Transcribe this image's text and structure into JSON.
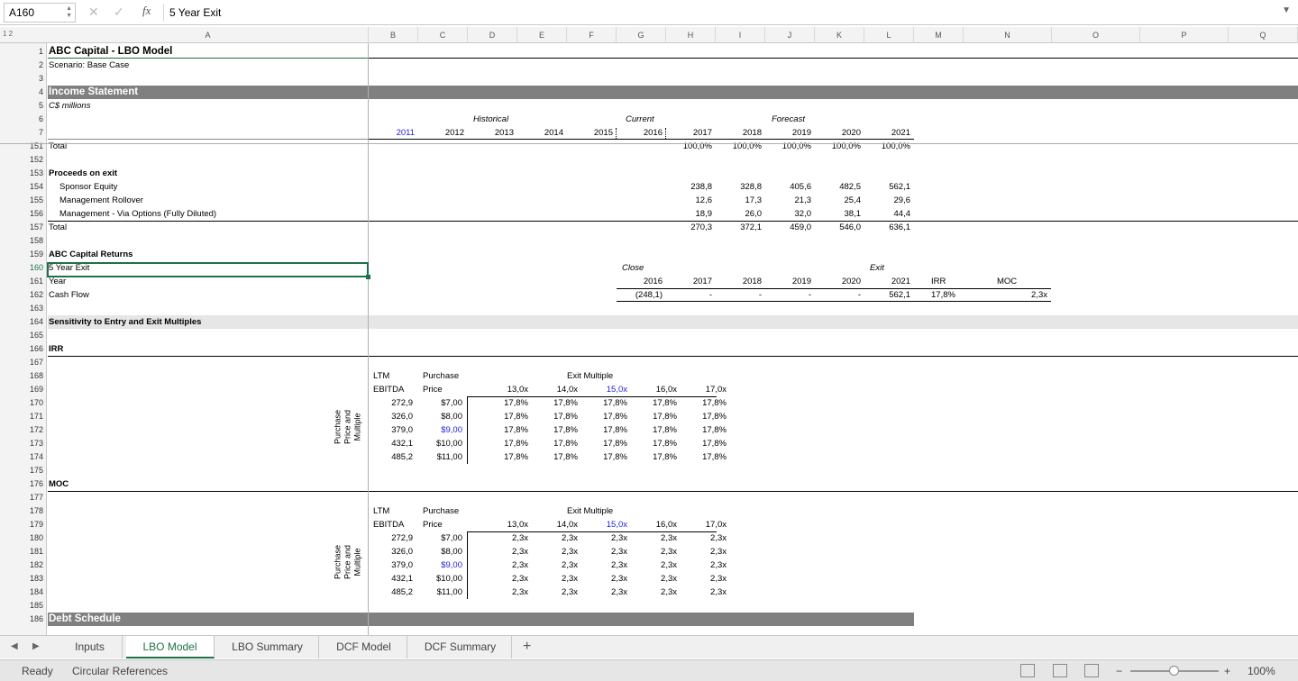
{
  "formula_bar": {
    "name_box": "A160",
    "cancel_icon": "✕",
    "confirm_icon": "✓",
    "fx_label": "fx",
    "formula": "5 Year Exit"
  },
  "outline_levels": "1 2",
  "columns": [
    "A",
    "B",
    "C",
    "D",
    "E",
    "F",
    "G",
    "H",
    "I",
    "J",
    "K",
    "L",
    "M",
    "N",
    "O",
    "P",
    "Q"
  ],
  "header_rows": {
    "r1": {
      "num": "1",
      "a": "ABC Capital - LBO Model"
    },
    "r2": {
      "num": "2",
      "a": "Scenario: Base Case"
    },
    "r3": {
      "num": "3"
    },
    "r4": {
      "num": "4",
      "a": "Income Statement"
    },
    "r5": {
      "num": "5",
      "a": "C$ millions"
    },
    "r6": {
      "num": "6",
      "historical": "Historical",
      "current": "Current",
      "forecast": "Forecast"
    },
    "r7": {
      "num": "7",
      "years": [
        "2011",
        "2012",
        "2013",
        "2014",
        "2015",
        "2016",
        "2017",
        "2018",
        "2019",
        "2020",
        "2021"
      ]
    }
  },
  "rows": {
    "r151": {
      "num": "151",
      "a": "Total",
      "values": [
        "100,0%",
        "100,0%",
        "100,0%",
        "100,0%",
        "100,0%"
      ]
    },
    "r152": {
      "num": "152"
    },
    "r153": {
      "num": "153",
      "a": "Proceeds on exit"
    },
    "r154": {
      "num": "154",
      "a": "Sponsor Equity",
      "values": [
        "238,8",
        "328,8",
        "405,6",
        "482,5",
        "562,1"
      ]
    },
    "r155": {
      "num": "155",
      "a": "Management Rollover",
      "values": [
        "12,6",
        "17,3",
        "21,3",
        "25,4",
        "29,6"
      ]
    },
    "r156": {
      "num": "156",
      "a": "Management - Via Options (Fully Diluted)",
      "values": [
        "18,9",
        "26,0",
        "32,0",
        "38,1",
        "44,4"
      ]
    },
    "r157": {
      "num": "157",
      "a": "Total",
      "values": [
        "270,3",
        "372,1",
        "459,0",
        "546,0",
        "636,1"
      ]
    },
    "r158": {
      "num": "158"
    },
    "r159": {
      "num": "159",
      "a": "ABC Capital Returns"
    },
    "r160": {
      "num": "160",
      "a": "5 Year Exit",
      "close": "Close",
      "exit": "Exit"
    },
    "r161": {
      "num": "161",
      "a": "Year",
      "years": [
        "2016",
        "2017",
        "2018",
        "2019",
        "2020",
        "2021"
      ],
      "irr_label": "IRR",
      "moc_label": "MOC"
    },
    "r162": {
      "num": "162",
      "a": "Cash Flow",
      "values": [
        "(248,1)",
        "-",
        "-",
        "-",
        "-",
        "562,1"
      ],
      "irr": "17,8%",
      "moc": "2,3x"
    },
    "r163": {
      "num": "163"
    },
    "r164": {
      "num": "164",
      "a": "Sensitivity to Entry and Exit Multiples"
    },
    "r165": {
      "num": "165"
    },
    "r166": {
      "num": "166",
      "a": "IRR"
    },
    "r167": {
      "num": "167"
    },
    "r175": {
      "num": "175"
    },
    "r176": {
      "num": "176",
      "a": "MOC"
    },
    "r177": {
      "num": "177"
    },
    "r185": {
      "num": "185"
    },
    "r186": {
      "num": "186",
      "a": "Debt Schedule"
    }
  },
  "irr_table": {
    "rows_start": 168,
    "ltm": "LTM",
    "ebitda": "EBITDA",
    "purchase": "Purchase",
    "price": "Price",
    "exit_multiple": "Exit Multiple",
    "side_label_1": "Purchase",
    "side_label_2": "Price and",
    "side_label_3": "Multiple",
    "multiples": [
      "13,0x",
      "14,0x",
      "15,0x",
      "16,0x",
      "17,0x"
    ],
    "ebitda_values": [
      "272,9",
      "326,0",
      "379,0",
      "432,1",
      "485,2"
    ],
    "prices": [
      "$7,00",
      "$8,00",
      "$9,00",
      "$10,00",
      "$11,00"
    ],
    "cells": [
      [
        "17,8%",
        "17,8%",
        "17,8%",
        "17,8%",
        "17,8%"
      ],
      [
        "17,8%",
        "17,8%",
        "17,8%",
        "17,8%",
        "17,8%"
      ],
      [
        "17,8%",
        "17,8%",
        "17,8%",
        "17,8%",
        "17,8%"
      ],
      [
        "17,8%",
        "17,8%",
        "17,8%",
        "17,8%",
        "17,8%"
      ],
      [
        "17,8%",
        "17,8%",
        "17,8%",
        "17,8%",
        "17,8%"
      ]
    ]
  },
  "moc_table": {
    "ltm": "LTM",
    "ebitda": "EBITDA",
    "purchase": "Purchase",
    "price": "Price",
    "exit_multiple": "Exit Multiple",
    "side_label_1": "Purchase",
    "side_label_2": "Price and",
    "side_label_3": "Multiple",
    "multiples": [
      "13,0x",
      "14,0x",
      "15,0x",
      "16,0x",
      "17,0x"
    ],
    "ebitda_values": [
      "272,9",
      "326,0",
      "379,0",
      "432,1",
      "485,2"
    ],
    "prices": [
      "$7,00",
      "$8,00",
      "$9,00",
      "$10,00",
      "$11,00"
    ],
    "cells": [
      [
        "2,3x",
        "2,3x",
        "2,3x",
        "2,3x",
        "2,3x"
      ],
      [
        "2,3x",
        "2,3x",
        "2,3x",
        "2,3x",
        "2,3x"
      ],
      [
        "2,3x",
        "2,3x",
        "2,3x",
        "2,3x",
        "2,3x"
      ],
      [
        "2,3x",
        "2,3x",
        "2,3x",
        "2,3x",
        "2,3x"
      ],
      [
        "2,3x",
        "2,3x",
        "2,3x",
        "2,3x",
        "2,3x"
      ]
    ]
  },
  "tabs": [
    "Inputs",
    "LBO Model",
    "LBO Summary",
    "DCF Model",
    "DCF Summary"
  ],
  "active_tab": "LBO Model",
  "add_sheet": "+",
  "status": {
    "ready": "Ready",
    "circular": "Circular References",
    "zoom": "100%",
    "minus": "−",
    "plus": "+"
  },
  "colors": {
    "accent": "#1e7145",
    "section_bar": "#808080",
    "input_blue": "#2222dd"
  }
}
